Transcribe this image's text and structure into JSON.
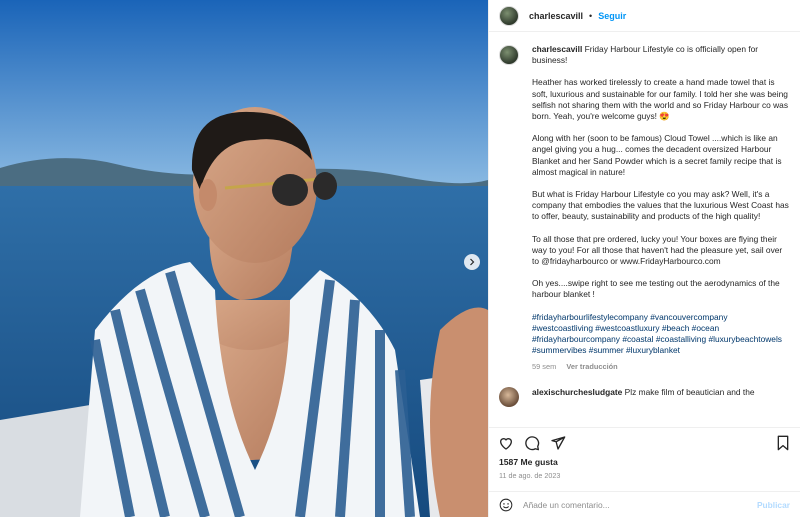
{
  "post": {
    "username": "charlescavill",
    "dot": "•",
    "follow_label": "Seguir"
  },
  "caption": {
    "username": "charlescavill",
    "p1": "Friday Harbour Lifestyle co is officially open for business!",
    "p2": "Heather has worked tirelessly to create a hand made towel that is soft, luxurious and sustainable for our family. I told her she was being selfish not sharing them with the world and so Friday Harbour co was born. Yeah, you're welcome guys! 😍",
    "p3": "Along with her (soon to be famous) Cloud Towel ....which is like an angel giving you a hug... comes the decadent oversized Harbour Blanket and her Sand Powder which is a secret family recipe that is almost magical in nature!",
    "p4": "But what is Friday Harbour Lifestyle co you may ask? Well, it's a company that embodies the values that the luxurious West Coast has to offer, beauty, sustainability and products of the high quality!",
    "p5": "To all those that pre ordered, lucky you! Your boxes are flying their way to you! For all those that haven't had the pleasure yet, sail over to @fridayharbourco or www.FridayHarbourco.com",
    "p6": "Oh yes....swipe right to see me testing out the aerodynamics of the harbour blanket !",
    "hashtags": "#fridayharbourlifestylecompany #vancouvercompany #westcoastliving #westcoastluxury #beach #ocean #fridayharbourcompany #coastal #coastalliving #luxurybeachtowels #summervibes #summer #luxuryblanket",
    "age": "59 sem",
    "translate": "Ver traducción"
  },
  "comment": {
    "username": "alexischurchesludgate",
    "text": "Plz make film of beautician and the"
  },
  "stats": {
    "likes": "1587 Me gusta",
    "date": "11 de ago. de 2023"
  },
  "composer": {
    "placeholder": "Añade un comentario...",
    "publish_label": "Publicar"
  },
  "colors": {
    "accent": "#0095f6",
    "link": "#00376b",
    "muted": "#8e8e8e"
  }
}
